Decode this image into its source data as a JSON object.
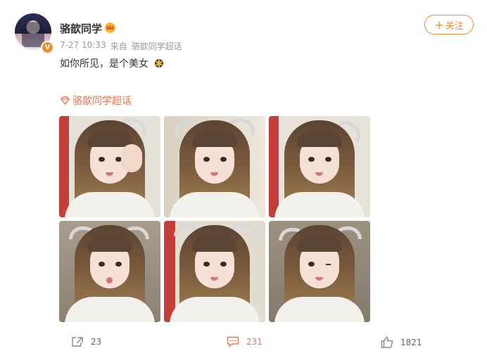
{
  "post": {
    "author": "骆歆同学",
    "time": "7-27 10:33",
    "source_prefix": "来自",
    "source": "骆歆同学超话",
    "text": "如你所见，是个美女",
    "topic": "骆歆同学超话",
    "verified_badge": "V"
  },
  "follow": {
    "plus": "+",
    "label": "关注"
  },
  "actions": {
    "share_count": "23",
    "comment_count": "231",
    "like_count": "1821"
  },
  "colors": {
    "accent": "#f08a2a",
    "topic": "#eb7350",
    "muted": "#999999"
  },
  "icons": [
    "crown-icon",
    "sparkle-emoji-icon",
    "topic-diamond-icon",
    "share-icon",
    "comment-icon",
    "like-icon"
  ]
}
